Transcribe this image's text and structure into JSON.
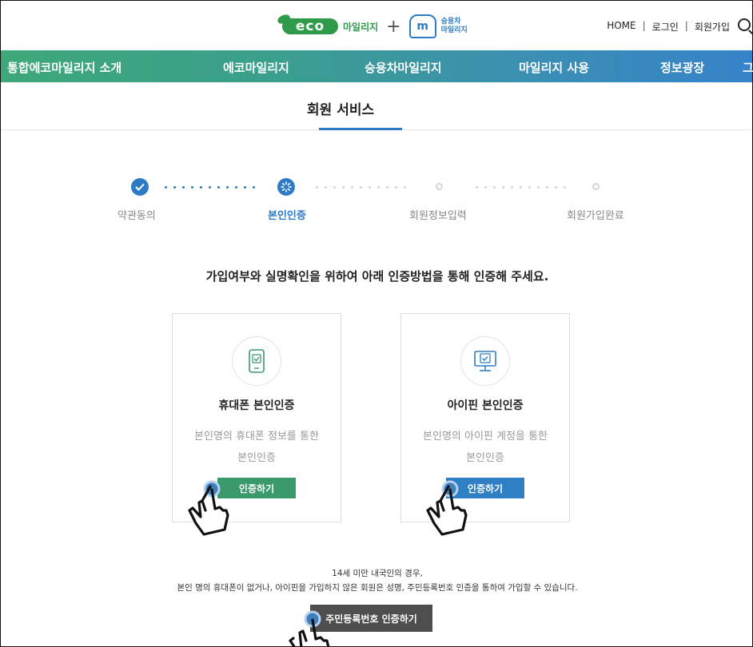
{
  "header": {
    "logo_eco": "eco",
    "logo_eco_sub": "마일리지",
    "logo_plus": "+",
    "logo_car_line1": "승용차",
    "logo_car_line2": "마일리지",
    "util": [
      "HOME",
      "로그인",
      "회원가입"
    ],
    "util_sep": "|"
  },
  "nav": {
    "items": [
      "통합에코마일리지 소개",
      "에코마일리지",
      "승용차마일리지",
      "마일리지 사용",
      "정보광장",
      "그"
    ]
  },
  "page": {
    "title": "회원 서비스"
  },
  "steps": [
    {
      "label": "약관동의",
      "state": "done"
    },
    {
      "label": "본인인증",
      "state": "current"
    },
    {
      "label": "회원정보입력",
      "state": "pending"
    },
    {
      "label": "회원가입완료",
      "state": "pending"
    }
  ],
  "intro": "가입여부와 실명확인을 위하여 아래 인증방법을 통해 인증해 주세요.",
  "cards": [
    {
      "title": "휴대폰 본인인증",
      "desc_line1": "본인명의 휴대폰 정보를 통한",
      "desc_line2": "본인인증",
      "button": "인증하기",
      "button_color": "#3a9a6c",
      "icon": "phone-check-icon"
    },
    {
      "title": "아이핀 본인인증",
      "desc_line1": "본인명의 아이핀 계정을 통한",
      "desc_line2": "본인인증",
      "button": "인증하기",
      "button_color": "#2f7fc4",
      "icon": "monitor-check-icon"
    }
  ],
  "notice_line1": "14세 미만 내국인의 경우,",
  "notice_line2": "본인 명의 휴대폰이 없거나, 아이핀을 가입하지 않은 회원은 성명, 주민등록번호 인증을 통하여 가입할 수 있습니다.",
  "rrn_button": "주민등록번호 인증하기",
  "colors": {
    "accent_blue": "#2c7bc4",
    "accent_green": "#3a9a6c",
    "pending_gray": "#d6d6d6"
  }
}
